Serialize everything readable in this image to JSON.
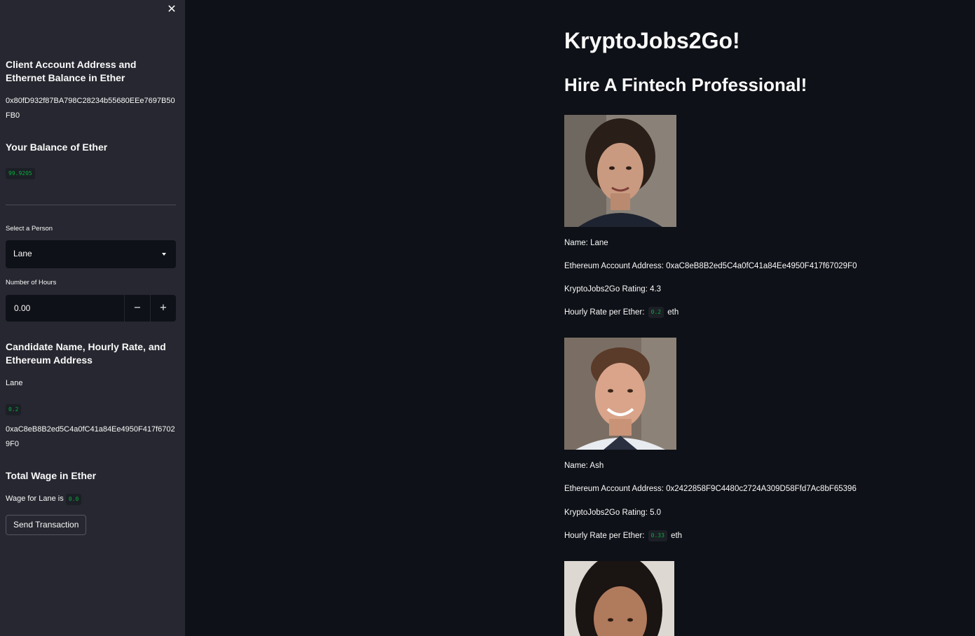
{
  "sidebar": {
    "close_icon": "close-icon",
    "client_heading": "Client Account Address and Ethernet Balance in Ether",
    "client_address": "0x80fD932f87BA798C28234b55680EEe7697B50FB0",
    "balance_heading": "Your Balance of Ether",
    "balance_value": "99.9205",
    "select_label": "Select a Person",
    "selected_person": "Lane",
    "hours_label": "Number of Hours",
    "hours_value": "0.00",
    "minus_label": "−",
    "plus_label": "+",
    "candidate_heading": "Candidate Name, Hourly Rate, and Ethereum Address",
    "candidate_name": "Lane",
    "candidate_rate": "0.2",
    "candidate_address": "0xaC8eB8B2ed5C4a0fC41a84Ee4950F417f67029F0",
    "wage_heading": "Total Wage in Ether",
    "wage_text": "Wage for Lane is",
    "wage_value": "0.0",
    "send_button": "Send Transaction"
  },
  "main": {
    "title": "KryptoJobs2Go!",
    "subtitle": "Hire A Fintech Professional!",
    "candidates": [
      {
        "name_line": "Name: Lane",
        "address_line": "Ethereum Account Address: 0xaC8eB8B2ed5C4a0fC41a84Ee4950F417f67029F0",
        "rating_line": "KryptoJobs2Go Rating: 4.3",
        "rate_label": "Hourly Rate per Ether:",
        "rate_value": "0.2",
        "rate_unit": "eth"
      },
      {
        "name_line": "Name: Ash",
        "address_line": "Ethereum Account Address: 0x2422858F9C4480c2724A309D58Ffd7Ac8bF65396",
        "rating_line": "KryptoJobs2Go Rating: 5.0",
        "rate_label": "Hourly Rate per Ether:",
        "rate_value": "0.33",
        "rate_unit": "eth"
      }
    ]
  },
  "colors": {
    "main_bg": "#0e1117",
    "sidebar_bg": "#262730",
    "code_green": "#09ab3b"
  }
}
